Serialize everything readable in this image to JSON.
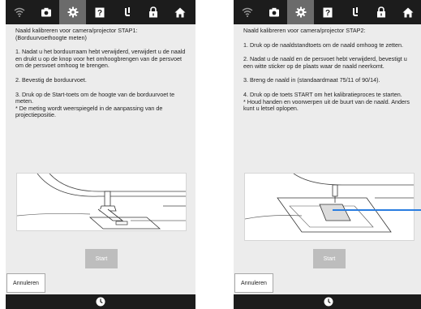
{
  "topbar": {
    "icons": [
      "wifi-icon",
      "camera-icon",
      "gear-icon",
      "help-icon",
      "needle-icon",
      "lock-icon",
      "home-icon"
    ],
    "active_icon": "gear-icon"
  },
  "left_screen": {
    "paragraphs": [
      "Naald kalibreren voor camera/projector STAP1:\n(Borduurvoethoogte meten)",
      "1. Nadat u het borduurraam hebt verwijderd, verwijdert u de naald en drukt u op de knop voor het omhoogbrengen van de persvoet om de persvoet omhoog te brengen.",
      "2. Bevestig de borduurvoet.",
      "3. Druk op de Start-toets om de hoogte van de borduurvoet te meten.\n * De meting wordt weerspiegeld in de aanpassing van de projectiepositie."
    ],
    "start_label": "Start",
    "cancel_label": "Annuleren"
  },
  "right_screen": {
    "paragraphs": [
      "Naald kalibreren voor camera/projector STAP2:",
      "1. Druk op de naaldstandtoets om de naald omhoog te zetten.",
      "2. Nadat u de naald en de persvoet hebt verwijderd, bevestigt u een witte sticker op de plaats waar de naald neerkomt.",
      "3. Breng de naald in (standaardmaat 75/11 of 90/14).",
      "4. Druk op de toets START om het kalibratieproces te starten.\n* Houd handen en voorwerpen uit de buurt van de naald. Anders kunt u letsel oplopen."
    ],
    "start_label": "Start",
    "cancel_label": "Annuleren"
  },
  "bottombar": {
    "icon": "clock-icon"
  },
  "colors": {
    "bar": "#1c1c1c",
    "active_tab": "#6b6b6b",
    "panel": "#ececec",
    "disabled_button": "#bdbdbd",
    "pointer_line": "#2a7de0"
  }
}
